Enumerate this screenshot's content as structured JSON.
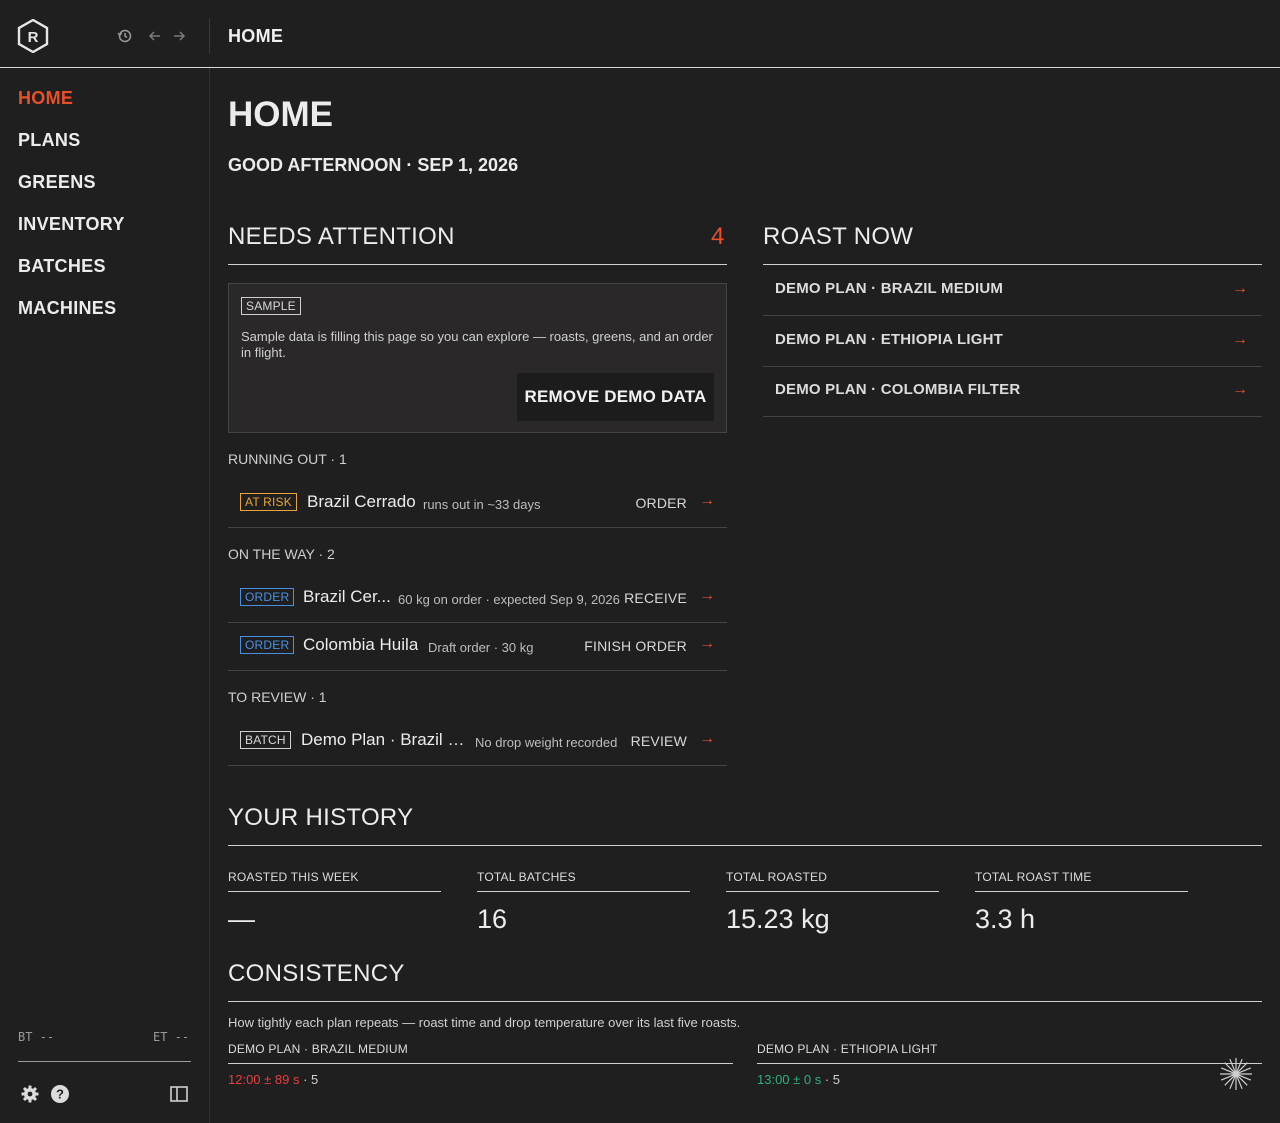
{
  "topbar": {
    "title": "HOME"
  },
  "sidebar": {
    "items": [
      {
        "label": "HOME",
        "active": true
      },
      {
        "label": "PLANS",
        "active": false
      },
      {
        "label": "GREENS",
        "active": false
      },
      {
        "label": "INVENTORY",
        "active": false
      },
      {
        "label": "BATCHES",
        "active": false
      },
      {
        "label": "MACHINES",
        "active": false
      }
    ],
    "bt_label": "BT",
    "bt_value": "--",
    "et_label": "ET",
    "et_value": "--"
  },
  "page": {
    "title": "HOME",
    "greeting": "GOOD AFTERNOON · SEP 1, 2026"
  },
  "needs_attention": {
    "title": "NEEDS ATTENTION",
    "count": "4",
    "sample": {
      "tag": "SAMPLE",
      "text": "Sample data is filling this page so you can explore — roasts, greens, and an order in flight.",
      "button": "REMOVE DEMO DATA"
    },
    "running_out": {
      "label": "RUNNING OUT · 1",
      "rows": [
        {
          "tag": "AT RISK",
          "name": "Brazil Cerrado",
          "meta": "runs out in ~33 days",
          "action": "ORDER"
        }
      ]
    },
    "on_the_way": {
      "label": "ON THE WAY · 2",
      "rows": [
        {
          "tag": "ORDER",
          "name": "Brazil Cer...",
          "meta": "60 kg on order · expected Sep 9, 2026",
          "action": "RECEIVE"
        },
        {
          "tag": "ORDER",
          "name": "Colombia Huila",
          "meta": "Draft order · 30 kg",
          "action": "FINISH ORDER"
        }
      ]
    },
    "to_review": {
      "label": "TO REVIEW · 1",
      "rows": [
        {
          "tag": "BATCH",
          "name": "Demo Plan · Brazil M...",
          "meta": "No drop weight recorded",
          "action": "REVIEW"
        }
      ]
    },
    "arrow": "→"
  },
  "roast_now": {
    "title": "ROAST NOW",
    "items": [
      {
        "label": "DEMO PLAN · BRAZIL MEDIUM"
      },
      {
        "label": "DEMO PLAN · ETHIOPIA LIGHT"
      },
      {
        "label": "DEMO PLAN · COLOMBIA FILTER"
      }
    ]
  },
  "history": {
    "title": "YOUR HISTORY",
    "stats": [
      {
        "label": "ROASTED THIS WEEK",
        "value": "—"
      },
      {
        "label": "TOTAL BATCHES",
        "value": "16"
      },
      {
        "label": "TOTAL ROASTED",
        "value": "15.23 kg"
      },
      {
        "label": "TOTAL ROAST TIME",
        "value": "3.3 h"
      }
    ]
  },
  "consistency": {
    "title": "CONSISTENCY",
    "description": "How tightly each plan repeats — roast time and drop temperature over its last five roasts.",
    "plans": [
      {
        "label": "DEMO PLAN · BRAZIL MEDIUM",
        "time": "12:00 ± 89 s",
        "sep": " · ",
        "count": "5",
        "color": "#e64040"
      },
      {
        "label": "DEMO PLAN · ETHIOPIA LIGHT",
        "time": "13:00 ± 0 s",
        "sep": " · ",
        "count": "5",
        "color": "#2fb07a"
      }
    ]
  },
  "colors": {
    "accent": "#e8502a",
    "at_risk": "#e8a33a",
    "order": "#4a8fe0"
  }
}
